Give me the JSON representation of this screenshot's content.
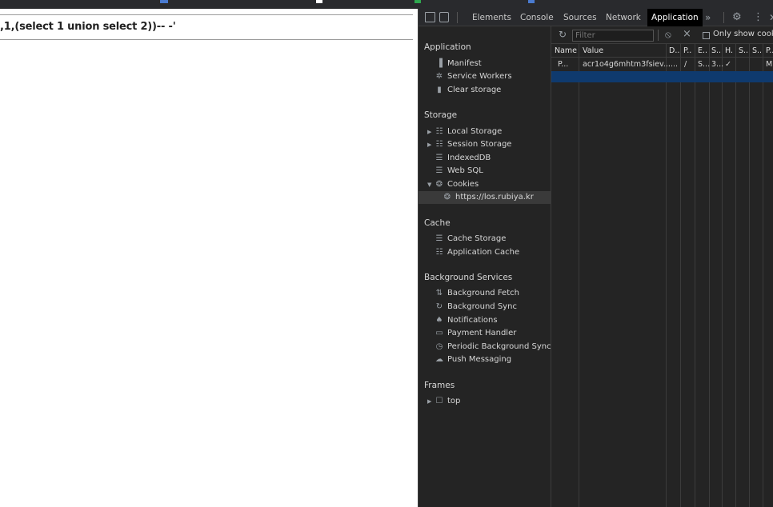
{
  "page": {
    "query_text": ",1,(select 1 union select 2))-- -'"
  },
  "devtools": {
    "tabs": [
      "Elements",
      "Console",
      "Sources",
      "Network",
      "Application"
    ],
    "active_tab": "Application",
    "more_label": "»",
    "sidebar": {
      "application": {
        "title": "Application",
        "items": [
          "Manifest",
          "Service Workers",
          "Clear storage"
        ]
      },
      "storage": {
        "title": "Storage",
        "items": [
          "Local Storage",
          "Session Storage",
          "IndexedDB",
          "Web SQL",
          "Cookies"
        ],
        "cookie_origin": "https://los.rubiya.kr"
      },
      "cache": {
        "title": "Cache",
        "items": [
          "Cache Storage",
          "Application Cache"
        ]
      },
      "background": {
        "title": "Background Services",
        "items": [
          "Background Fetch",
          "Background Sync",
          "Notifications",
          "Payment Handler",
          "Periodic Background Sync",
          "Push Messaging"
        ]
      },
      "frames": {
        "title": "Frames",
        "items": [
          "top"
        ]
      }
    },
    "filter": {
      "placeholder": "Filter",
      "only_show_label": "Only show cookie"
    },
    "cookie_table": {
      "headers": [
        "Name",
        "Value",
        "D..",
        "P..",
        "E..",
        "S..",
        "H.",
        "S..",
        "S..",
        "P.."
      ],
      "rows": [
        [
          "P...",
          "acr1o4g6mhtm3fsiev...",
          "....",
          "/",
          "S...",
          "3...",
          "✓",
          "",
          "",
          "M"
        ]
      ]
    }
  }
}
